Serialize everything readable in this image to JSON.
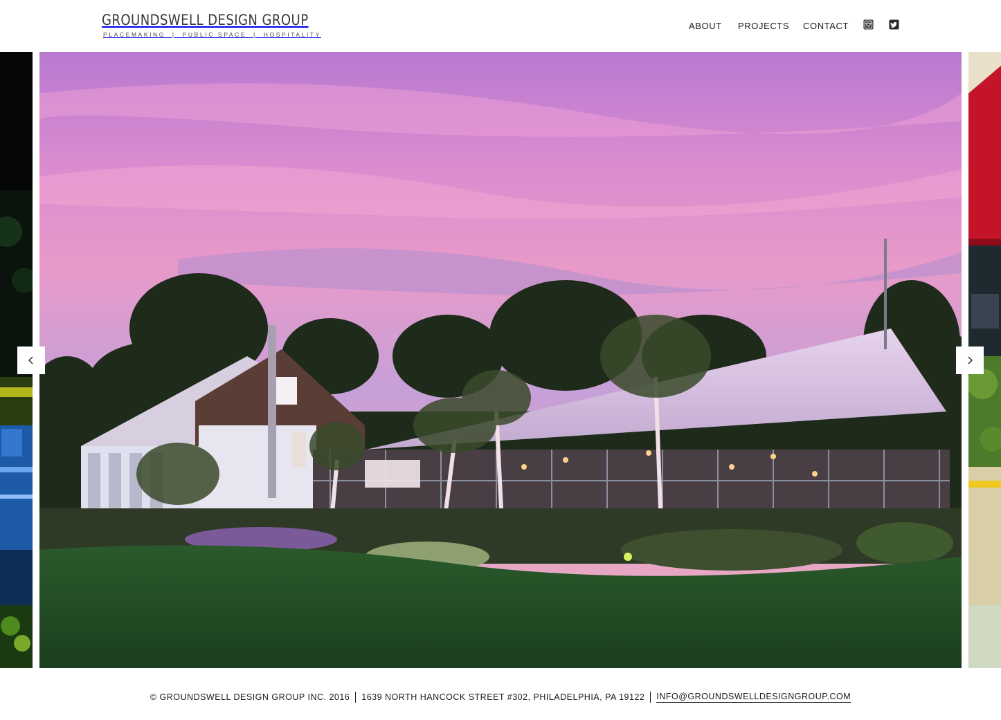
{
  "header": {
    "brand_name": "GROUNDSWELL DESIGN GROUP",
    "tagline": "PLACEMAKING  |  PUBLIC SPACE  |  HOSPITALITY"
  },
  "nav": {
    "items": [
      {
        "label": "ABOUT"
      },
      {
        "label": "PROJECTS"
      },
      {
        "label": "CONTACT"
      }
    ],
    "social": [
      "instagram-icon",
      "twitter-icon"
    ]
  },
  "carousel": {
    "current_slide": "Greenhouse restaurant at dusk with pink sky",
    "prev_arrow_icon": "chevron-left-icon",
    "next_arrow_icon": "chevron-right-icon"
  },
  "footer": {
    "copyright": "© GROUNDSWELL DESIGN GROUP INC. 2016",
    "address": "1639 NORTH HANCOCK STREET #302, PHILADELPHIA, PA 19122",
    "email": "INFO@GROUNDSWELLDESIGNGROUP.COM"
  },
  "colors": {
    "background": "#ffffff",
    "text": "#1a1a1a",
    "sky_top": "#c87fcf",
    "sky_mid": "#e88cc4",
    "grass": "#2d5a2e"
  }
}
